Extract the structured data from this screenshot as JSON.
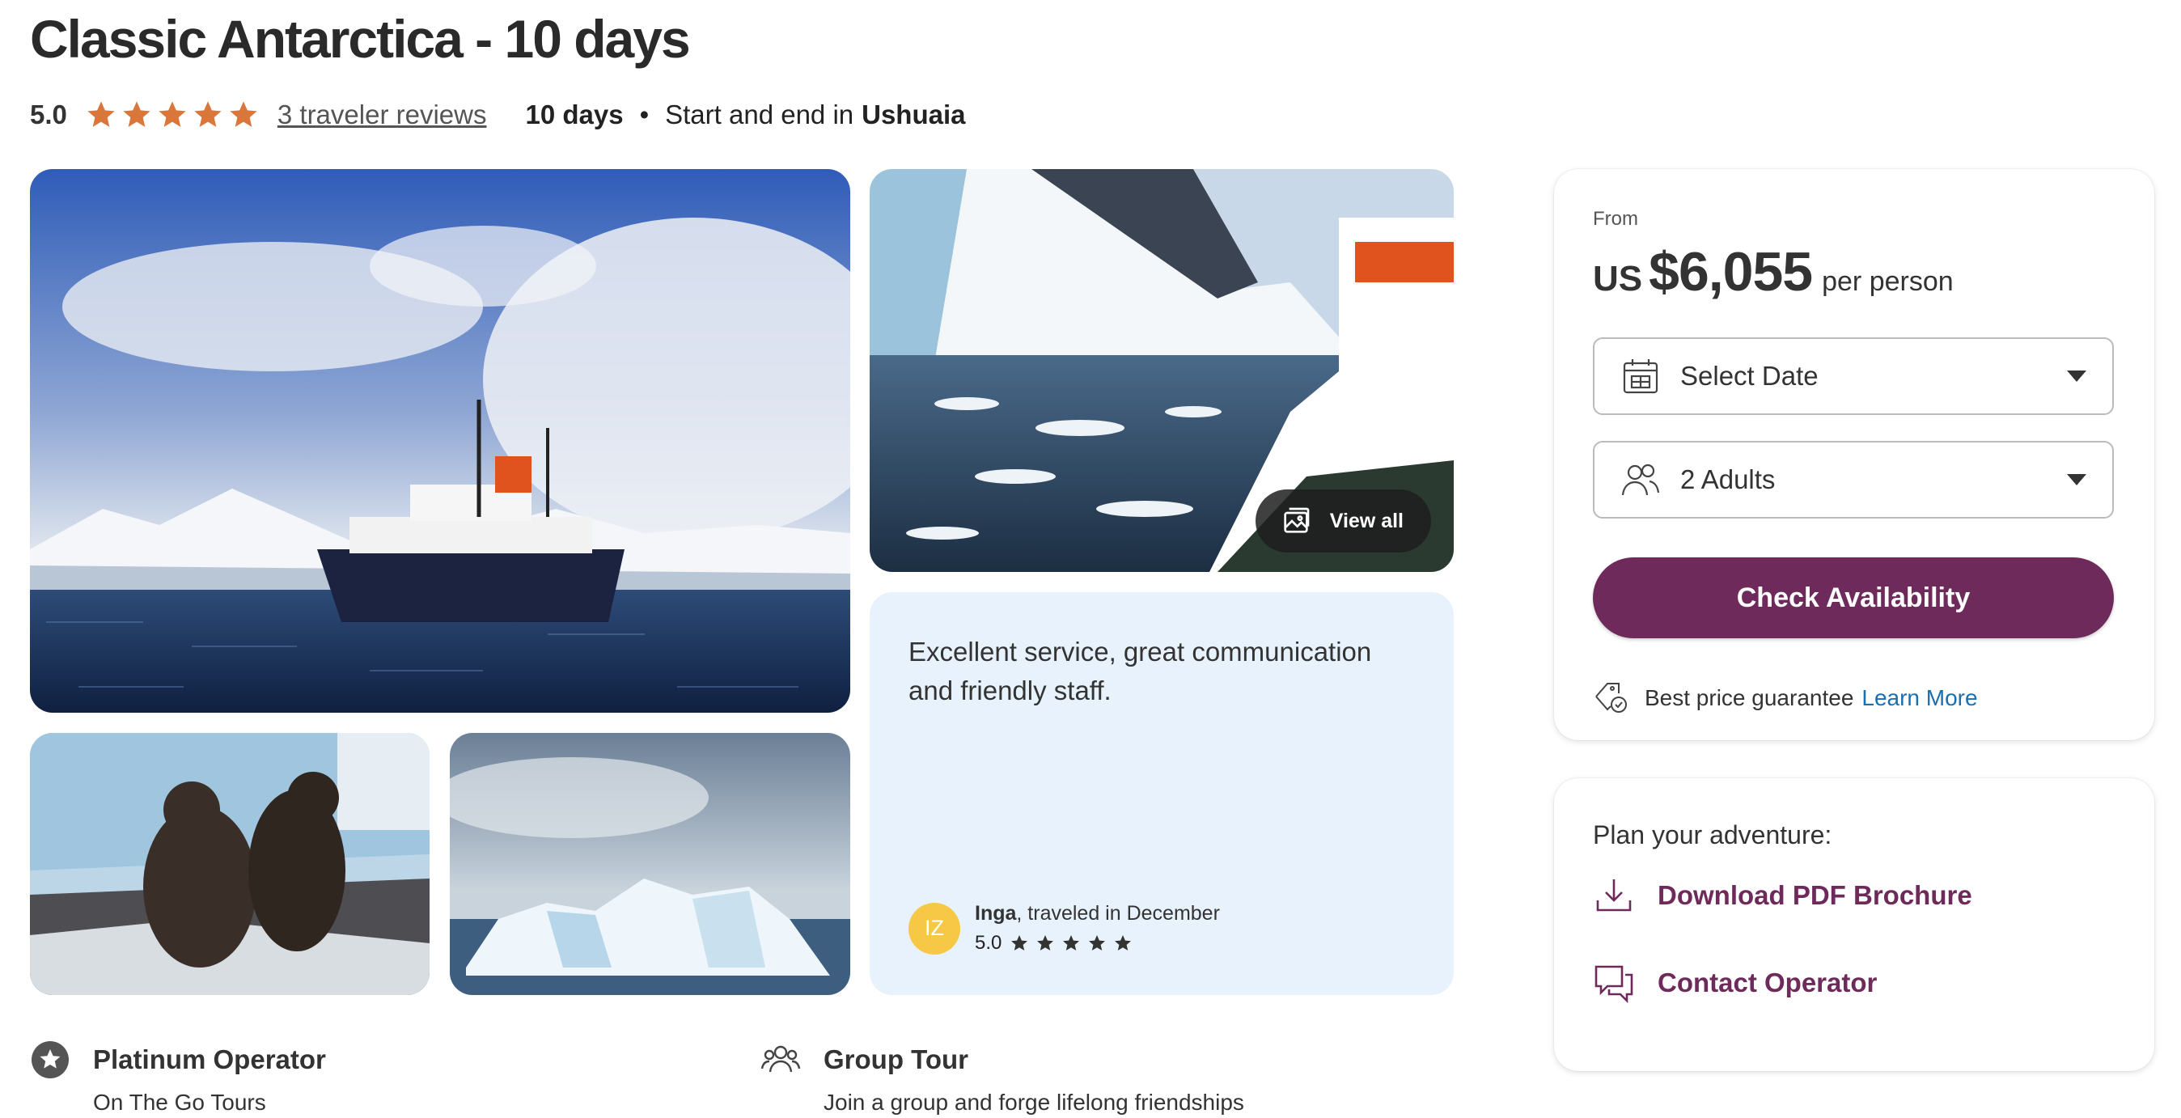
{
  "tour": {
    "title": "Classic Antarctica - 10 days",
    "rating": "5.0",
    "star_count": 5,
    "reviews_link": "3 traveler reviews",
    "duration": "10 days",
    "dot": "•",
    "route_prefix": "Start and end in",
    "route_place": "Ushuaia"
  },
  "gallery": {
    "view_all_label": "View all"
  },
  "review": {
    "text": "Excellent service, great communication and friendly staff.",
    "avatar_initials": "IZ",
    "name": "Inga",
    "traveled": ", traveled in December",
    "rating": "5.0"
  },
  "features": [
    {
      "title": "Platinum Operator",
      "subtitle": "On The Go Tours",
      "icon": "star-badge-icon"
    },
    {
      "title": "Group Tour",
      "subtitle": "Join a group and forge lifelong friendships",
      "icon": "group-icon"
    }
  ],
  "booking": {
    "from_label": "From",
    "currency": "US",
    "price": "$6,055",
    "per_label": "per person",
    "date_select": "Select Date",
    "guests_select": "2 Adults",
    "check_button": "Check Availability",
    "guarantee_text": "Best price guarantee",
    "learn_more": "Learn More"
  },
  "plan": {
    "title": "Plan your adventure:",
    "download_label": "Download PDF Brochure",
    "contact_label": "Contact Operator"
  },
  "colors": {
    "star": "#d9773a",
    "brand": "#6e2a5a",
    "link": "#1a6fb0",
    "review_bg": "#e8f2fc",
    "avatar": "#f7c845"
  }
}
